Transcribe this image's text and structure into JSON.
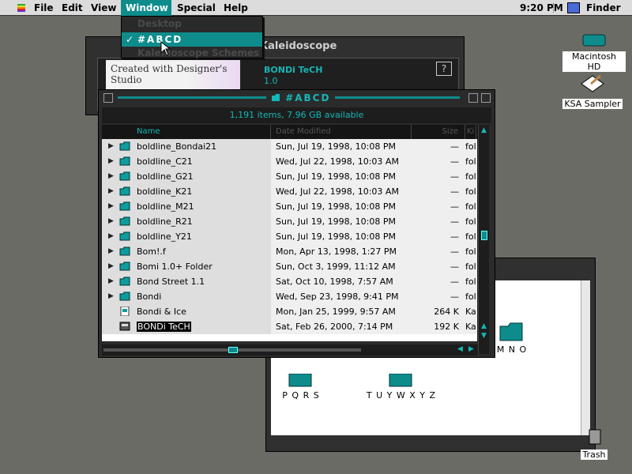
{
  "menubar": {
    "items": [
      "File",
      "Edit",
      "View",
      "Window",
      "Special",
      "Help"
    ],
    "open_item": "Window",
    "time": "9:20 PM",
    "app": "Finder"
  },
  "window_menu": {
    "items": [
      "Desktop",
      "#ABCD",
      "Kaleidoscope Schemes"
    ],
    "selected": "#ABCD"
  },
  "desktop": {
    "icons": [
      "Macintosh HD",
      "KSA Sampler",
      "Trash"
    ]
  },
  "kaleidoscope": {
    "title": "Kaleidoscope",
    "product_name": "BONDi TeCH",
    "version": "1.0",
    "promo_text": "Created with Designer's Studio"
  },
  "fonts_window": {
    "folder_labels": [
      "M N O",
      "P Q R S",
      "T U Y W X Y Z"
    ]
  },
  "main_window": {
    "title": "#ABCD",
    "info": "1,191 items, 7.96 GB available",
    "columns": {
      "name": "Name",
      "date": "Date Modified",
      "size": "Size",
      "kind": "Ki"
    },
    "rows": [
      {
        "name": "boldline_Bondai21",
        "date": "Sun, Jul 19, 1998, 10:08 PM",
        "size": "—",
        "kind": "fol",
        "type": "folder"
      },
      {
        "name": "boldline_C21",
        "date": "Wed, Jul 22, 1998, 10:03 AM",
        "size": "—",
        "kind": "fol",
        "type": "folder"
      },
      {
        "name": "boldline_G21",
        "date": "Sun, Jul 19, 1998, 10:08 PM",
        "size": "—",
        "kind": "fol",
        "type": "folder"
      },
      {
        "name": "boldline_K21",
        "date": "Wed, Jul 22, 1998, 10:03 AM",
        "size": "—",
        "kind": "fol",
        "type": "folder"
      },
      {
        "name": "boldline_M21",
        "date": "Sun, Jul 19, 1998, 10:08 PM",
        "size": "—",
        "kind": "fol",
        "type": "folder"
      },
      {
        "name": "boldline_R21",
        "date": "Sun, Jul 19, 1998, 10:08 PM",
        "size": "—",
        "kind": "fol",
        "type": "folder"
      },
      {
        "name": "boldline_Y21",
        "date": "Sun, Jul 19, 1998, 10:08 PM",
        "size": "—",
        "kind": "fol",
        "type": "folder"
      },
      {
        "name": "Bom!.f",
        "date": "Mon, Apr 13, 1998, 1:27 PM",
        "size": "—",
        "kind": "fol",
        "type": "folder"
      },
      {
        "name": "Bomi 1.0+ Folder",
        "date": "Sun, Oct 3, 1999, 11:12 AM",
        "size": "—",
        "kind": "fol",
        "type": "folder"
      },
      {
        "name": "Bond Street 1.1",
        "date": "Sat, Oct 10, 1998, 7:57 AM",
        "size": "—",
        "kind": "fol",
        "type": "folder"
      },
      {
        "name": "Bondi",
        "date": "Wed, Sep 23, 1998, 9:41 PM",
        "size": "—",
        "kind": "fol",
        "type": "folder"
      },
      {
        "name": "Bondi & Ice",
        "date": "Mon, Jan 25, 1999, 9:57 AM",
        "size": "264 K",
        "kind": "Ka",
        "type": "file"
      },
      {
        "name": "BONDi TeCH",
        "date": "Sat, Feb 26, 2000, 7:14 PM",
        "size": "192 K",
        "kind": "Ka",
        "type": "app"
      }
    ]
  }
}
